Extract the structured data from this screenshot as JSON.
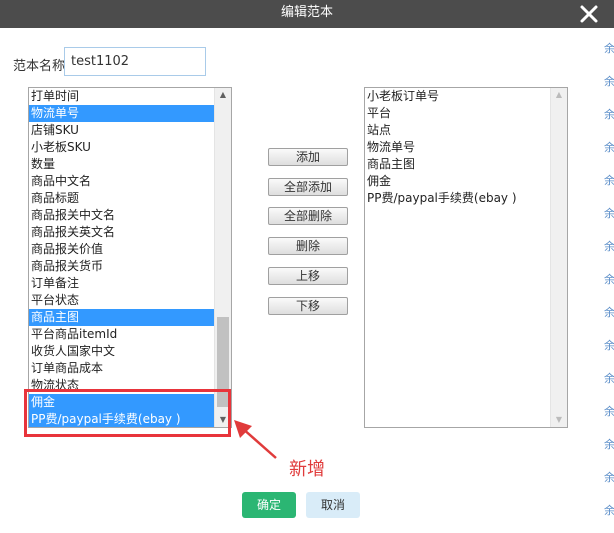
{
  "dialog": {
    "title": "编辑范本",
    "close_icon": "close-icon"
  },
  "form": {
    "name_label": "范本名称",
    "name_value": "test1102"
  },
  "left_list": {
    "items": [
      {
        "label": "打单时间",
        "selected": false
      },
      {
        "label": "物流单号",
        "selected": true
      },
      {
        "label": "店铺SKU",
        "selected": false
      },
      {
        "label": "小老板SKU",
        "selected": false
      },
      {
        "label": "数量",
        "selected": false
      },
      {
        "label": "商品中文名",
        "selected": false
      },
      {
        "label": "商品标题",
        "selected": false
      },
      {
        "label": "商品报关中文名",
        "selected": false
      },
      {
        "label": "商品报关英文名",
        "selected": false
      },
      {
        "label": "商品报关价值",
        "selected": false
      },
      {
        "label": "商品报关货币",
        "selected": false
      },
      {
        "label": "订单备注",
        "selected": false
      },
      {
        "label": "平台状态",
        "selected": false
      },
      {
        "label": "商品主图",
        "selected": true
      },
      {
        "label": "平台商品itemId",
        "selected": false
      },
      {
        "label": "收货人国家中文",
        "selected": false
      },
      {
        "label": "订单商品成本",
        "selected": false
      },
      {
        "label": "物流状态",
        "selected": false
      },
      {
        "label": "佣金",
        "selected": true
      },
      {
        "label": "PP费/paypal手续费(ebay )",
        "selected": true
      }
    ]
  },
  "right_list": {
    "items": [
      {
        "label": "小老板订单号"
      },
      {
        "label": "平台"
      },
      {
        "label": "站点"
      },
      {
        "label": "物流单号"
      },
      {
        "label": "商品主图"
      },
      {
        "label": "佣金"
      },
      {
        "label": "PP费/paypal手续费(ebay )"
      }
    ]
  },
  "buttons": {
    "add": "添加",
    "add_all": "全部添加",
    "remove_all": "全部删除",
    "remove": "删除",
    "move_up": "上移",
    "move_down": "下移"
  },
  "annotation": {
    "text": "新增",
    "color": "#e03b3b"
  },
  "footer": {
    "ok": "确定",
    "cancel": "取消"
  },
  "colors": {
    "titlebar": "#4c4c4c",
    "selection": "#3399ff",
    "ok_button": "#2bb673",
    "cancel_button": "#d9ecf8",
    "highlight": "#e8343b"
  },
  "edge_glyphs": [
    "余",
    "余",
    "余",
    "余",
    "余",
    "余",
    "余",
    "余",
    "余",
    "余",
    "余",
    "余",
    "余",
    "余",
    "余"
  ]
}
